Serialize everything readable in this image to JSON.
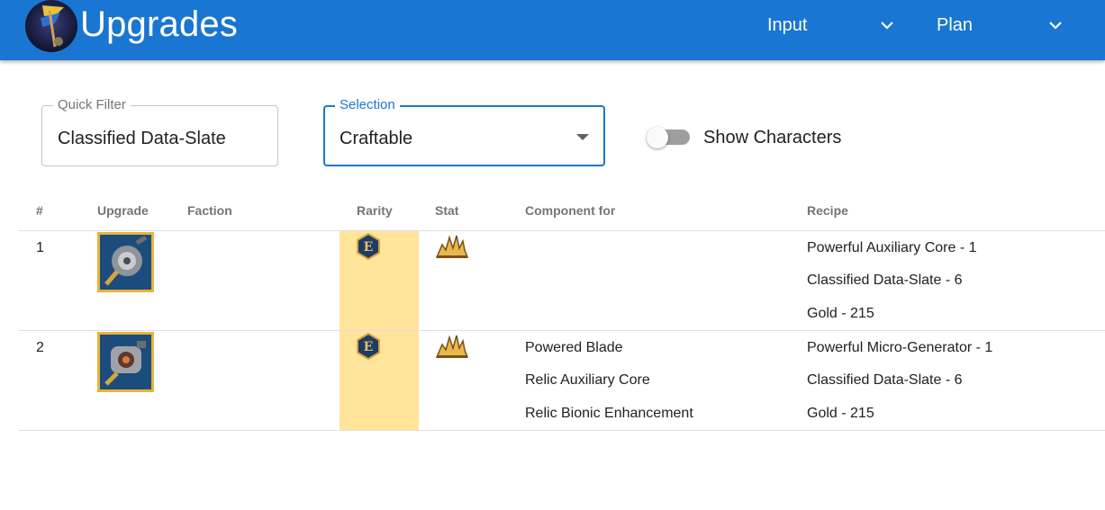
{
  "app": {
    "title": "Upgrades",
    "nav": [
      {
        "label": "Input",
        "icon": "chevron-down-icon"
      },
      {
        "label": "Plan",
        "icon": "chevron-down-icon"
      }
    ]
  },
  "filters": {
    "quick_filter": {
      "label": "Quick Filter",
      "value": "Classified Data-Slate"
    },
    "selection": {
      "label": "Selection",
      "value": "Craftable"
    },
    "show_characters": {
      "label": "Show Characters",
      "checked": false
    }
  },
  "table": {
    "columns": [
      "#",
      "Upgrade",
      "Faction",
      "Rarity",
      "Stat",
      "Component for",
      "Recipe"
    ],
    "rows": [
      {
        "num": "1",
        "upgrade_icon": "auxiliary-core-icon",
        "faction": "",
        "rarity_icon": "epic-rarity-icon",
        "rarity_letter": "E",
        "stat_icon": "burst-stat-icon",
        "component_for": [],
        "recipe": [
          "Powerful Auxiliary Core - 1",
          "Classified Data-Slate - 6",
          "Gold - 215"
        ]
      },
      {
        "num": "2",
        "upgrade_icon": "micro-generator-icon",
        "faction": "",
        "rarity_icon": "epic-rarity-icon",
        "rarity_letter": "E",
        "stat_icon": "burst-stat-icon",
        "component_for": [
          "Powered Blade",
          "Relic Auxiliary Core",
          "Relic Bionic Enhancement"
        ],
        "recipe": [
          "Powerful Micro-Generator - 1",
          "Classified Data-Slate - 6",
          "Gold - 215"
        ]
      }
    ]
  },
  "colors": {
    "appbar": "#1976d2",
    "rarity_highlight": "#ffe49a",
    "accent": "#1976d2"
  }
}
